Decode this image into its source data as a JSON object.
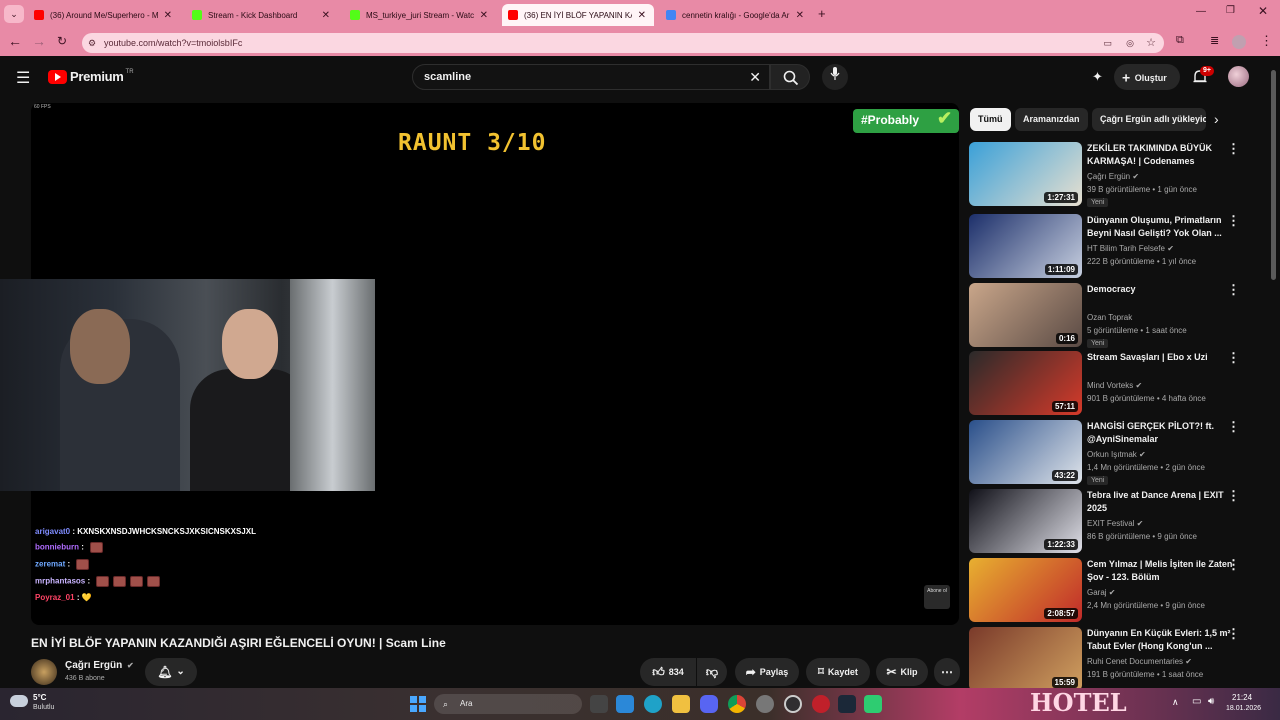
{
  "browser": {
    "tabs": [
      {
        "title": "(36) Around Me/Superhero - M",
        "color": "#ff0000"
      },
      {
        "title": "Stream - Kick Dashboard",
        "color": "#53fc18"
      },
      {
        "title": "MS_turkiye_juri Stream - Watch",
        "color": "#53fc18"
      },
      {
        "title": "(36) EN İYİ BLÖF YAPANIN KAZ",
        "color": "#ff0000",
        "active": true
      },
      {
        "title": "cennetin kralığı - Google'da Ar",
        "color": "#4285f4"
      }
    ],
    "url": "youtube.com/watch?v=tmoiolsbIFc"
  },
  "youtube": {
    "brand": "Premium",
    "brand_sup": "TR",
    "search_value": "scamline",
    "create_label": "Oluştur",
    "notif_count": "9+",
    "player": {
      "fps_label": "60 FPS",
      "round_text": "Raunt 3/10",
      "badge_text": "#Probably",
      "corner_logo": "Abone ol"
    },
    "chat": [
      {
        "user": "arigavat0",
        "color": "#7f8cff",
        "msg": "KXNSKXNSDJWHCKSNCKSJXKSICNSKXSJXL",
        "emotes": 0
      },
      {
        "user": "bonnieburn",
        "color": "#b06cff",
        "msg": "",
        "emotes": 1
      },
      {
        "user": "zeremat",
        "color": "#6fa8ff",
        "msg": "",
        "emotes": 1
      },
      {
        "user": "mrphantasos",
        "color": "#c9b4ff",
        "msg": "",
        "emotes": 4
      },
      {
        "user": "Poyraz_01",
        "color": "#ff4466",
        "msg": "💛",
        "emotes": 0
      }
    ],
    "video_title": "EN İYİ BLÖF YAPANIN KAZANDIĞI AŞIRI EĞLENCELİ OYUN! | Scam Line",
    "channel_name": "Çağrı Ergün",
    "subscribers": "436 B abone",
    "actions": {
      "likes": "834",
      "share": "Paylaş",
      "save": "Kaydet",
      "clip": "Klip"
    },
    "chips": [
      "Tümü",
      "Aramanızdan",
      "Çağrı Ergün adlı yükleyic"
    ],
    "recommendations": [
      {
        "title": "ZEKİLER TAKIMINDA BÜYÜK KARMAŞA! | Codenames",
        "channel": "Çağrı Ergün",
        "verified": true,
        "meta": "39 B görüntüleme • 1 gün önce",
        "badge": "Yeni",
        "duration": "1:27:31",
        "c1": "#3aa0d8",
        "c2": "#e8e0d0"
      },
      {
        "title": "Dünyanın Oluşumu, Primatların Beyni Nasıl Gelişti? Yok Olan ...",
        "channel": "HT Bilim Tarih Felsefe",
        "verified": true,
        "meta": "222 B görüntüleme • 1 yıl önce",
        "badge": "",
        "duration": "1:11:09",
        "c1": "#1c2f6a",
        "c2": "#c8d0e0"
      },
      {
        "title": "Democracy",
        "channel": "Ozan Toprak",
        "verified": false,
        "meta": "5 görüntüleme • 1 saat önce",
        "badge": "Yeni",
        "duration": "0:16",
        "c1": "#c9a68a",
        "c2": "#5a4a44"
      },
      {
        "title": "Stream Savaşları | Ebo x Uzi",
        "channel": "Mind Vorteks",
        "verified": true,
        "meta": "901 B görüntüleme • 4 hafta önce",
        "badge": "",
        "duration": "57:11",
        "c1": "#2a2a2a",
        "c2": "#d63a2a"
      },
      {
        "title": "HANGİSİ GERÇEK PİLOT?! ft. @AyniSinemalar",
        "channel": "Orkun Işıtmak",
        "verified": true,
        "meta": "1,4 Mn görüntüleme • 2 gün önce",
        "badge": "Yeni",
        "duration": "43:22",
        "c1": "#2a4f8a",
        "c2": "#dfe4ea"
      },
      {
        "title": "Tebra live at Dance Arena  |  EXIT 2025",
        "channel": "EXIT Festival",
        "verified": true,
        "meta": "86 B görüntüleme • 9 gün önce",
        "badge": "",
        "duration": "1:22:33",
        "c1": "#101018",
        "c2": "#e0e0e8"
      },
      {
        "title": "Cem Yılmaz | Melis İşiten ile Zaten Şov - 123. Bölüm",
        "channel": "Garaj",
        "verified": true,
        "meta": "2,4 Mn görüntüleme • 9 gün önce",
        "badge": "",
        "duration": "2:08:57",
        "c1": "#e8b030",
        "c2": "#c02a2a"
      },
      {
        "title": "Dünyanın En Küçük Evleri: 1,5 m² Tabut Evler (Hong Kong'un ...",
        "channel": "Ruhi Cenet Documentaries",
        "verified": true,
        "meta": "191 B görüntüleme • 1 saat önce",
        "badge": "",
        "duration": "15:59",
        "c1": "#7a3a2a",
        "c2": "#d0a060"
      }
    ]
  },
  "taskbar": {
    "weather_temp": "5°C",
    "weather_desc": "Bulutlu",
    "search_label": "Ara",
    "banner_text": "HOTEL",
    "time": "21:24",
    "date": "18.01.2026"
  },
  "colors": {
    "tab_bar": "#e88aa6",
    "yt_red": "#ff0000",
    "probably_green": "#2ea043",
    "raunt_yellow": "#f2c230"
  }
}
